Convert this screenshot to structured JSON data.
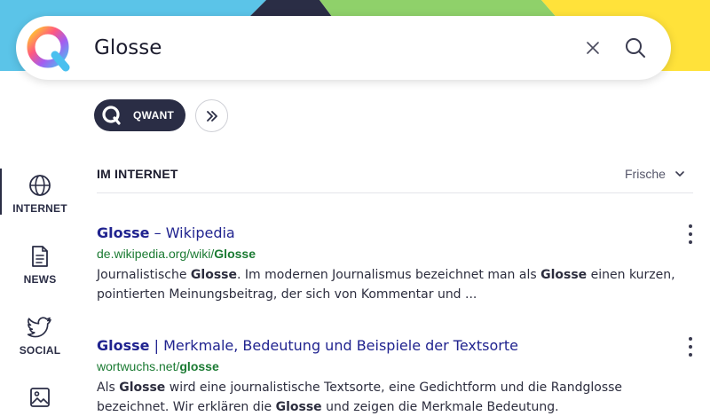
{
  "search": {
    "query": "Glosse"
  },
  "chips": {
    "qwant_label": "QWANT"
  },
  "sidebar": {
    "items": [
      {
        "label": "INTERNET",
        "icon": "globe-icon",
        "active": true
      },
      {
        "label": "NEWS",
        "icon": "newspaper-icon",
        "active": false
      },
      {
        "label": "SOCIAL",
        "icon": "twitter-bird-icon",
        "active": false
      },
      {
        "label": "",
        "icon": "image-icon",
        "active": false
      }
    ]
  },
  "results_header": {
    "title": "IM INTERNET",
    "sort_label": "Frische"
  },
  "results": [
    {
      "title_bold": "Glosse",
      "title_rest": " – Wikipedia",
      "url_plain": "de.wikipedia.org/wiki/",
      "url_bold": "Glosse",
      "snippet": [
        {
          "t": "Journalistische ",
          "b": false
        },
        {
          "t": "Glosse",
          "b": true
        },
        {
          "t": ". Im modernen Journalismus bezeichnet man als ",
          "b": false
        },
        {
          "t": "Glosse",
          "b": true
        },
        {
          "t": " einen kurzen, pointierten Meinungsbeitrag, der sich von Kommentar und ...",
          "b": false
        }
      ]
    },
    {
      "title_bold": "Glosse",
      "title_rest": " | Merkmale, Bedeutung und Beispiele der Textsorte",
      "url_plain": "wortwuchs.net/",
      "url_bold": "glosse",
      "snippet": [
        {
          "t": "Als ",
          "b": false
        },
        {
          "t": "Glosse",
          "b": true
        },
        {
          "t": " wird eine journalistische Textsorte, eine Gedichtform und die Randglosse bezeichnet. Wir erklären die ",
          "b": false
        },
        {
          "t": "Glosse",
          "b": true
        },
        {
          "t": " und zeigen die Merkmale Bedeutung.",
          "b": false
        }
      ]
    }
  ],
  "colors": {
    "band_blue": "#5bc4e8",
    "band_navy": "#2a2d45",
    "band_green": "#8fd16a",
    "band_yellow": "#ffe23a",
    "link_title": "#20238f",
    "link_url": "#1a7a32"
  }
}
